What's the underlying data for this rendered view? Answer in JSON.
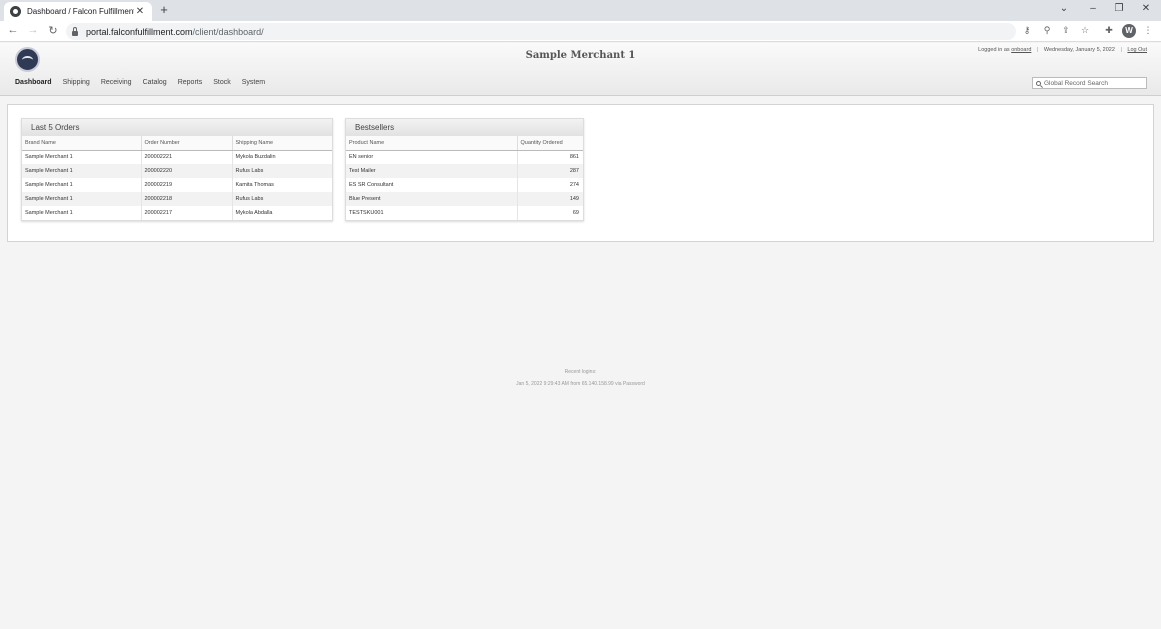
{
  "browser": {
    "tab_title": "Dashboard / Falcon Fulfillment",
    "url_host": "portal.falconfulfillment.com",
    "url_path": "/client/dashboard/",
    "profile_initial": "W"
  },
  "header": {
    "merchant_name": "Sample Merchant 1",
    "logged_in_prefix": "Logged in as",
    "username": "onboard",
    "date": "Wednesday, January 5, 2022",
    "logout": "Log Out",
    "search_placeholder": "Global Record Search"
  },
  "nav": {
    "items": [
      "Dashboard",
      "Shipping",
      "Receiving",
      "Catalog",
      "Reports",
      "Stock",
      "System"
    ]
  },
  "last_orders": {
    "title": "Last 5 Orders",
    "columns": [
      "Brand Name",
      "Order Number",
      "Shipping Name"
    ],
    "rows": [
      [
        "Sample Merchant 1",
        "200002221",
        "Mykola Buzdalin"
      ],
      [
        "Sample Merchant 1",
        "200002220",
        "Rufus Labs"
      ],
      [
        "Sample Merchant 1",
        "200002219",
        "Kamita Thomas"
      ],
      [
        "Sample Merchant 1",
        "200002218",
        "Rufus Labs"
      ],
      [
        "Sample Merchant 1",
        "200002217",
        "Mykola Abdalla"
      ]
    ]
  },
  "bestsellers": {
    "title": "Bestsellers",
    "columns": [
      "Product Name",
      "Quantity Ordered"
    ],
    "rows": [
      [
        "EN senior",
        "861"
      ],
      [
        "Test Mailer",
        "287"
      ],
      [
        "ES SR Consultant",
        "274"
      ],
      [
        "Blue Present",
        "149"
      ],
      [
        "TESTSKU001",
        "69"
      ]
    ]
  },
  "footer": {
    "recent_logins_label": "Recent logins:",
    "recent_login_entry": "Jan 5, 2022 9:29:43 AM from 65.140.158.99 via Password"
  }
}
